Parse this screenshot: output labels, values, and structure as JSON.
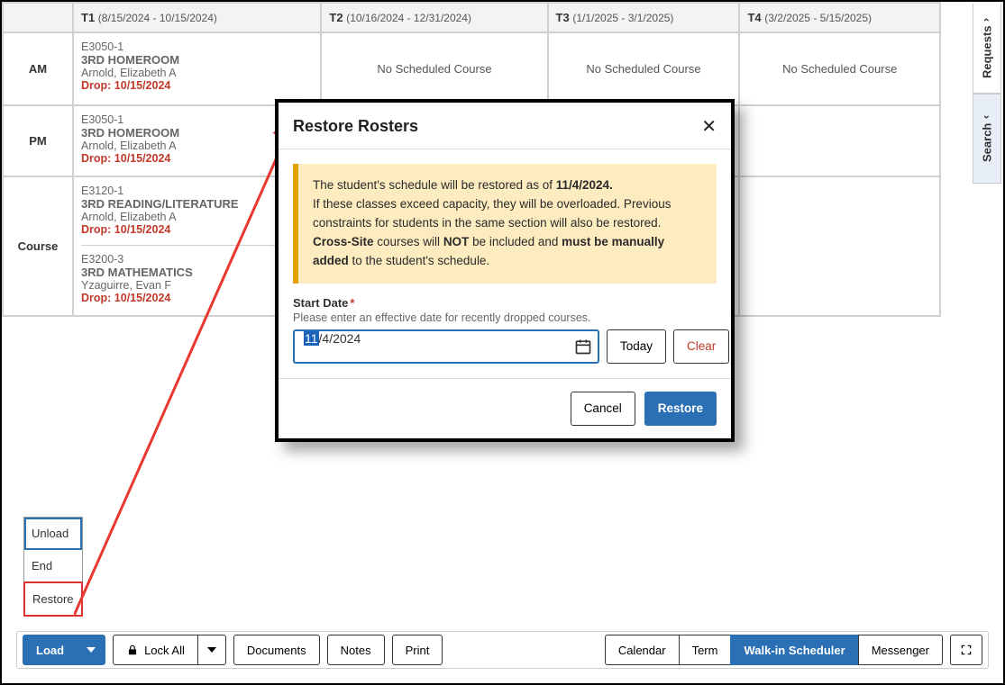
{
  "terms": [
    {
      "code": "T1",
      "range": "(8/15/2024 - 10/15/2024)"
    },
    {
      "code": "T2",
      "range": "(10/16/2024 - 12/31/2024)"
    },
    {
      "code": "T3",
      "range": "(1/1/2025 - 3/1/2025)"
    },
    {
      "code": "T4",
      "range": "(3/2/2025 - 5/15/2025)"
    }
  ],
  "periods": {
    "am": "AM",
    "pm": "PM",
    "course": "Course"
  },
  "no_course": "No Scheduled Course",
  "am_t1": {
    "code": "E3050-1",
    "name": "3RD HOMEROOM",
    "teacher": "Arnold, Elizabeth A",
    "drop": "Drop: 10/15/2024"
  },
  "pm_t1": {
    "code": "E3050-1",
    "name": "3RD HOMEROOM",
    "teacher": "Arnold, Elizabeth A",
    "drop": "Drop: 10/15/2024"
  },
  "course_t1_a": {
    "code": "E3120-1",
    "name": "3RD READING/LITERATURE",
    "teacher": "Arnold, Elizabeth A",
    "drop": "Drop: 10/15/2024"
  },
  "course_t1_b": {
    "code": "E3200-3",
    "name": "3RD MATHEMATICS",
    "teacher": "Yzaguirre, Evan F",
    "drop": "Drop: 10/15/2024"
  },
  "side": {
    "requests": "Requests",
    "search": "Search"
  },
  "menu": {
    "unload": "Unload",
    "end": "End",
    "restore": "Restore"
  },
  "toolbar": {
    "load": "Load",
    "lockall": "Lock All",
    "documents": "Documents",
    "notes": "Notes",
    "print": "Print",
    "calendar": "Calendar",
    "term": "Term",
    "walkin": "Walk-in Scheduler",
    "messenger": "Messenger"
  },
  "modal": {
    "title": "Restore Rosters",
    "alert_line1_a": "The student's schedule will be restored as of ",
    "alert_line1_b": "11/4/2024.",
    "alert_line2": "If these classes exceed capacity, they will be overloaded. Previous constraints for students in the same section will also be restored.",
    "alert_line3_a": "Cross-Site",
    "alert_line3_b": " courses will ",
    "alert_line3_c": "NOT",
    "alert_line3_d": " be included and ",
    "alert_line3_e": "must be manually added",
    "alert_line3_f": " to the student's schedule.",
    "field_label": "Start Date",
    "hint": "Please enter an effective date for recently dropped courses.",
    "date_sel": "11",
    "date_rest": "/4/2024",
    "today": "Today",
    "clear": "Clear",
    "cancel": "Cancel",
    "restore": "Restore"
  }
}
